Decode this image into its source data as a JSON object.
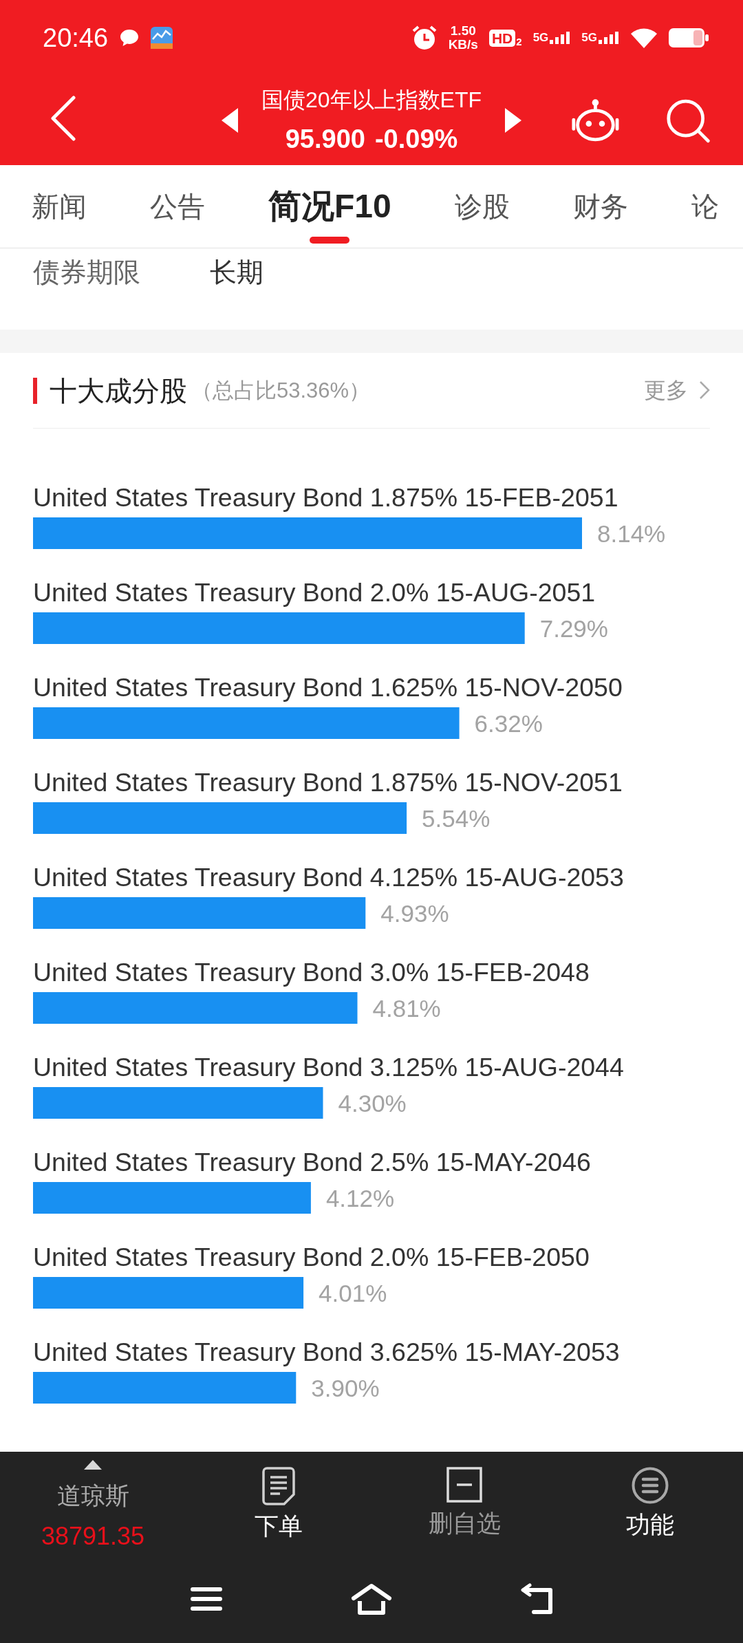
{
  "status_bar": {
    "time": "20:46",
    "net_speed": "1.50",
    "net_speed_unit": "KB/s",
    "hd_label": "HD",
    "hd_index": "2",
    "signals": [
      {
        "label": "5G"
      },
      {
        "label": "5G"
      }
    ]
  },
  "header": {
    "title": "国债20年以上指数ETF",
    "price": "95.900",
    "change": "-0.09%"
  },
  "tabs": [
    {
      "label": "新闻",
      "selected": false
    },
    {
      "label": "公告",
      "selected": false
    },
    {
      "label": "简况F10",
      "selected": true
    },
    {
      "label": "诊股",
      "selected": false
    },
    {
      "label": "财务",
      "selected": false
    },
    {
      "label": "论",
      "selected": false
    }
  ],
  "info": [
    {
      "label": "债券期限",
      "value": "长期"
    }
  ],
  "holdings": {
    "title": "十大成分股",
    "subtitle": "（总占比53.36%）",
    "more": "更多",
    "chart_data": {
      "type": "bar",
      "orientation": "horizontal",
      "categories": [
        "United States Treasury Bond 1.875% 15-FEB-2051",
        "United States Treasury Bond 2.0% 15-AUG-2051",
        "United States Treasury Bond 1.625% 15-NOV-2050",
        "United States Treasury Bond 1.875% 15-NOV-2051",
        "United States Treasury Bond 4.125% 15-AUG-2053",
        "United States Treasury Bond 3.0% 15-FEB-2048",
        "United States Treasury Bond 3.125% 15-AUG-2044",
        "United States Treasury Bond 2.5% 15-MAY-2046",
        "United States Treasury Bond 2.0% 15-FEB-2050",
        "United States Treasury Bond 3.625% 15-MAY-2053"
      ],
      "values": [
        8.14,
        7.29,
        6.32,
        5.54,
        4.93,
        4.81,
        4.3,
        4.12,
        4.01,
        3.9
      ],
      "value_labels": [
        "8.14%",
        "7.29%",
        "6.32%",
        "5.54%",
        "4.93%",
        "4.81%",
        "4.30%",
        "4.12%",
        "4.01%",
        "3.90%"
      ]
    }
  },
  "bottom_bar": {
    "index": {
      "name": "道琼斯",
      "value": "38791.35"
    },
    "actions": [
      {
        "kind": "order",
        "label": "下单"
      },
      {
        "kind": "remove",
        "label": "删自选"
      },
      {
        "kind": "functions",
        "label": "功能"
      }
    ]
  }
}
